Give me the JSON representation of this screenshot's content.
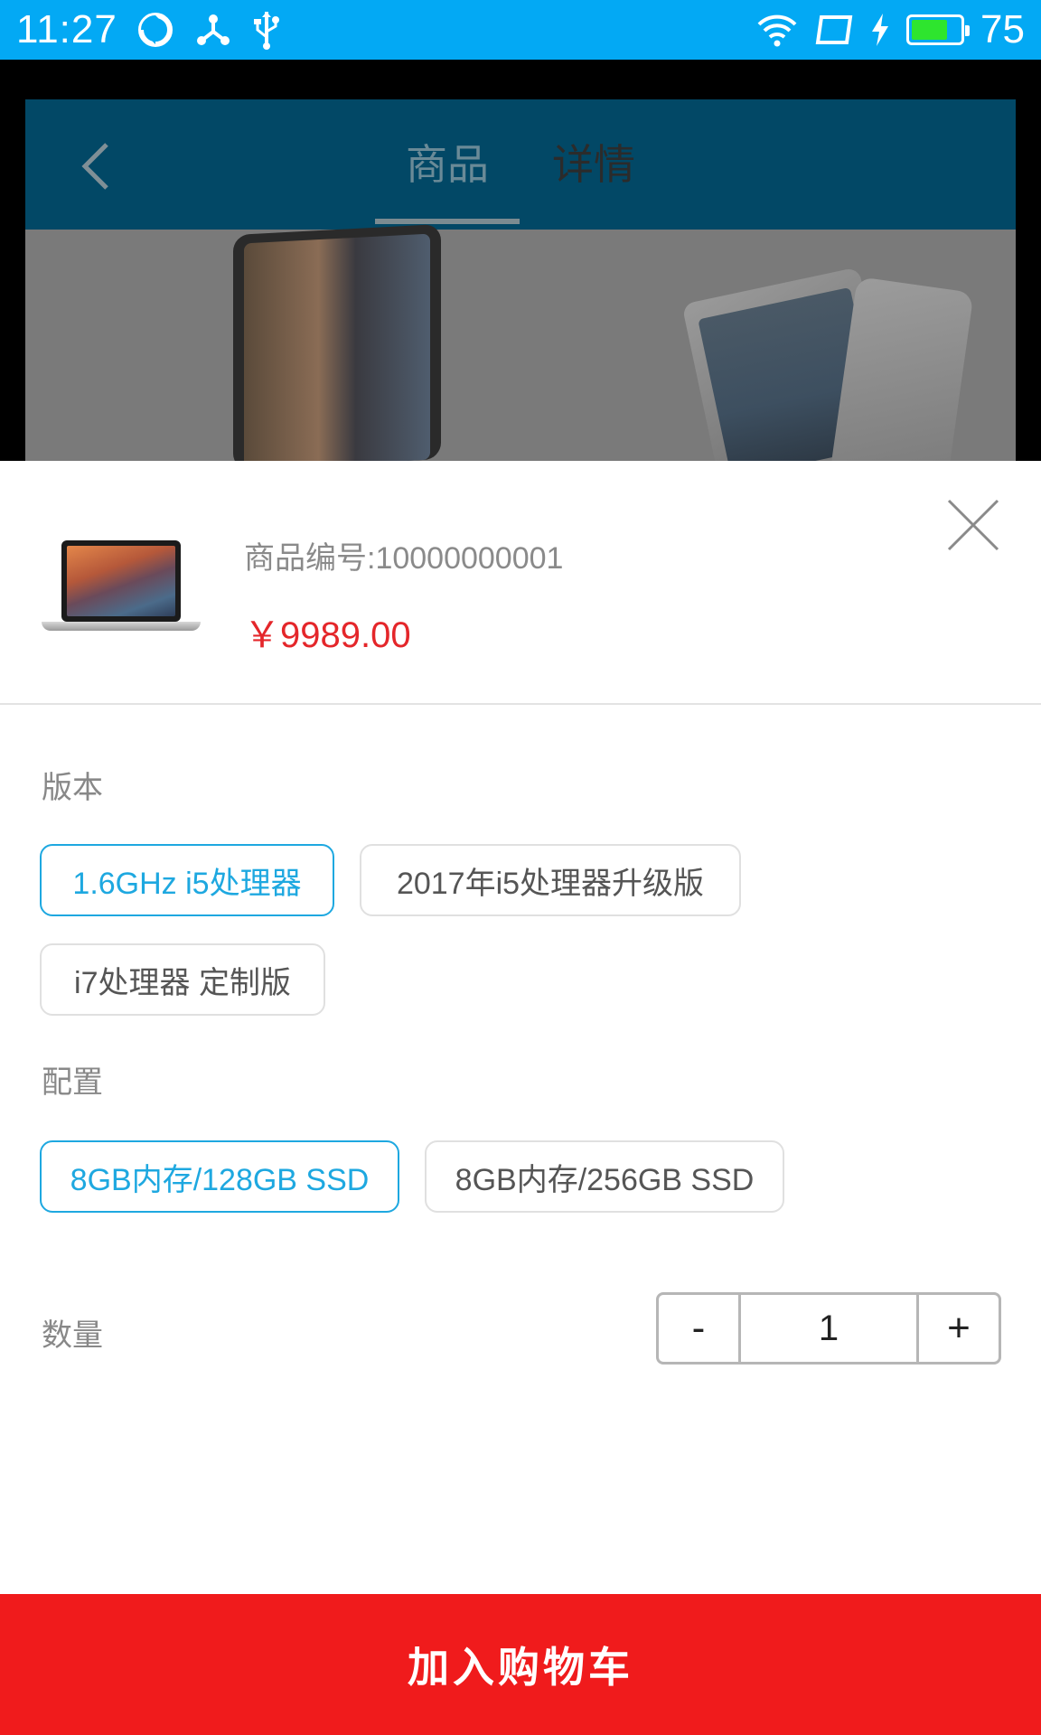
{
  "status_bar": {
    "time": "11:27",
    "battery_level": "75",
    "battery_fill_percent": 75,
    "icons": [
      "sync-icon",
      "share-network-icon",
      "usb-icon",
      "wifi-icon",
      "screen-rotate-icon",
      "charging-bolt-icon",
      "battery-icon"
    ]
  },
  "header": {
    "tabs": [
      {
        "label": "商品",
        "active": true
      },
      {
        "label": "详情",
        "active": false
      }
    ]
  },
  "product": {
    "code_label": "商品编号:10000000001",
    "price": "￥9989.00"
  },
  "version": {
    "label": "版本",
    "options": [
      {
        "label": "1.6GHz i5处理器",
        "selected": true
      },
      {
        "label": "2017年i5处理器升级版",
        "selected": false
      },
      {
        "label": "i7处理器 定制版",
        "selected": false
      }
    ]
  },
  "config": {
    "label": "配置",
    "options": [
      {
        "label": "8GB内存/128GB SSD",
        "selected": true
      },
      {
        "label": "8GB内存/256GB SSD",
        "selected": false
      }
    ]
  },
  "quantity": {
    "label": "数量",
    "minus": "-",
    "value": "1",
    "plus": "+"
  },
  "actions": {
    "add_to_cart": "加入购物车"
  },
  "colors": {
    "status_bar": "#03a9f4",
    "accent": "#1ea8e0",
    "price": "#e4262a",
    "cart_button": "#f01b1c"
  }
}
